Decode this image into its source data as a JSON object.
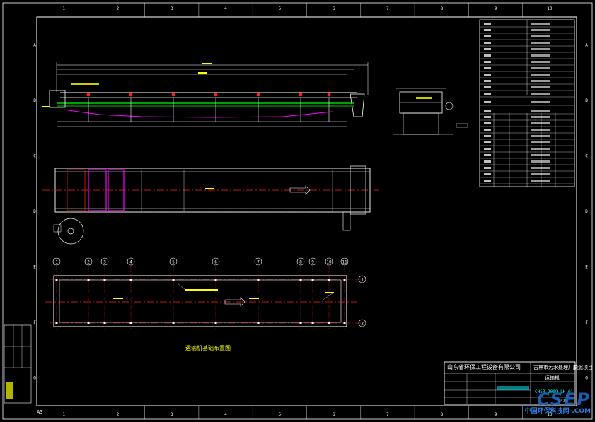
{
  "drawing": {
    "title": "运输机",
    "plan_caption": "运输机基础布置图",
    "company": "山东省环保工程设备有限公司",
    "project": "吉林市污水处理厂脱泥项目",
    "drawing_no": "CHSB-2009-LH-01",
    "scale": "1:25",
    "sheet_size": "A3"
  },
  "grid": {
    "top_numbers": [
      "1",
      "2",
      "3",
      "4",
      "5",
      "6",
      "7",
      "8",
      "9",
      "10"
    ],
    "side_letters": [
      "A",
      "B",
      "C",
      "D",
      "E",
      "F",
      "G"
    ]
  },
  "plan_axes": {
    "columns": [
      "1",
      "2",
      "3",
      "4",
      "5",
      "6",
      "7",
      "8",
      "9",
      "10",
      "11"
    ],
    "rows": [
      "1",
      "2"
    ]
  },
  "watermark": {
    "logo": "CSEP",
    "text": "中国环保科技网-.COM"
  },
  "colors": {
    "frame": "#ffffff",
    "yellow": "#ffff00",
    "red": "#ff2020",
    "magenta": "#ff00ff",
    "green": "#00ff00",
    "cyan": "#00ffff",
    "blue": "#1e6fd0"
  }
}
